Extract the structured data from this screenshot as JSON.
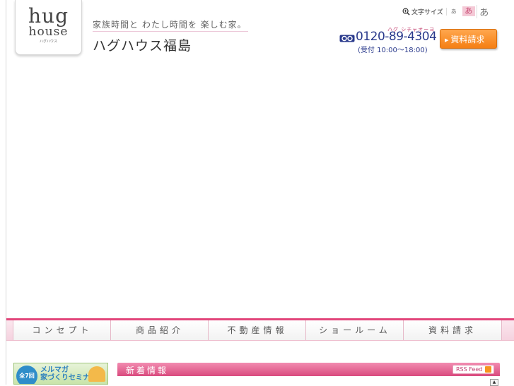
{
  "logo": {
    "line1": "hug",
    "line2": "house",
    "line3": "ハグハウス"
  },
  "header": {
    "tagline": "家族時間と わたし時間を 楽しむ家。",
    "title": "ハグハウス福島"
  },
  "font_size": {
    "label": "文字サイズ",
    "small": "あ",
    "medium": "あ",
    "large": "あ"
  },
  "phone": {
    "reading": "ハグ シチャオーヨ",
    "number": "0120-89-4304",
    "hours": "(受付 10:00〜18:00)"
  },
  "request_button": {
    "label": "資料請求"
  },
  "nav": {
    "items": [
      {
        "label": "コンセプト"
      },
      {
        "label": "商品紹介"
      },
      {
        "label": "不動産情報"
      },
      {
        "label": "ショールーム"
      },
      {
        "label": "資料請求"
      }
    ]
  },
  "banner": {
    "badge": "全7回",
    "line1": "メルマガ",
    "line2": "家づくりセミナー"
  },
  "news": {
    "title": "新着情報",
    "rss": "RSS Feed"
  },
  "colors": {
    "accent_pink": "#e2457a",
    "phone_blue": "#2a3a8c",
    "button_orange": "#f57f13"
  }
}
